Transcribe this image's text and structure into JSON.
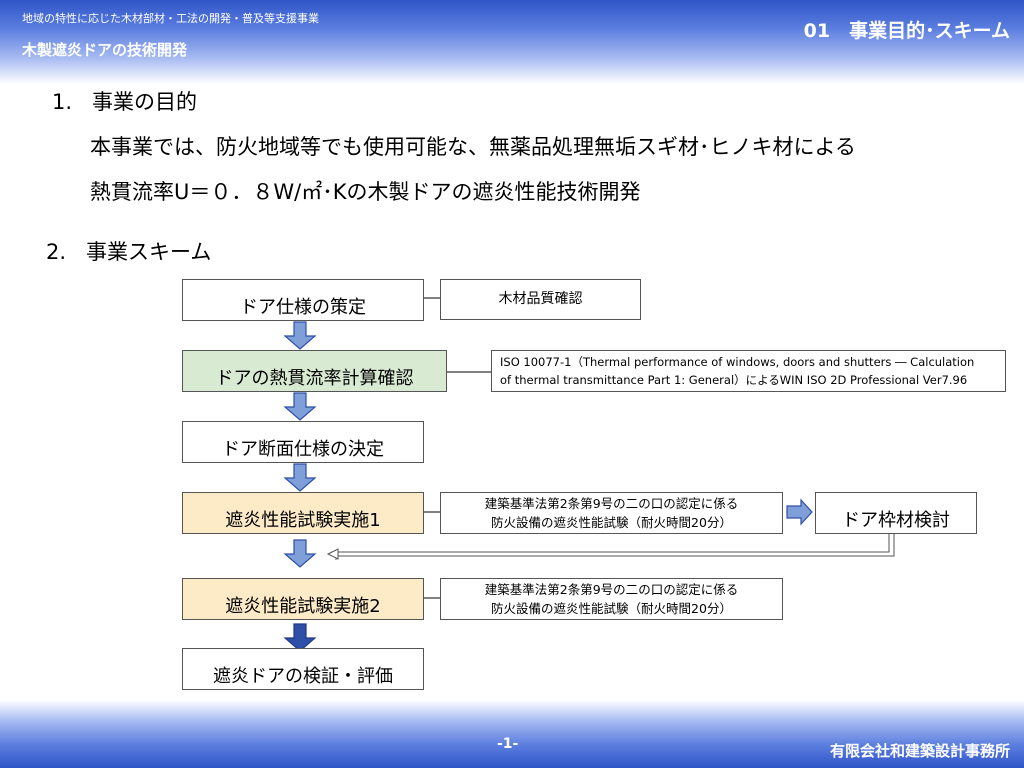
{
  "header": {
    "subtitle": "地域の特性に応じた木材部材・工法の開発・普及等支援事業",
    "title": "木製遮炎ドアの技術開発",
    "section_label": "01　事業目的･スキーム"
  },
  "sections": [
    {
      "number": "1.",
      "heading": "事業の目的"
    },
    {
      "number": "2.",
      "heading": "事業スキーム"
    }
  ],
  "purpose_lines": [
    "本事業では、防火地域等でも使用可能な、無薬品処理無垢スギ材･ヒノキ材による",
    "熱貫流率U＝０．８W/㎡･Kの木製ドアの遮炎性能技術開発"
  ],
  "flow_steps": [
    "ドア仕様の策定",
    "ドアの熱貫流率計算確認",
    "ドア断面仕様の決定",
    "遮炎性能試験実施1",
    "遮炎性能試験実施2",
    "遮炎ドアの検証・評価"
  ],
  "side_notes": {
    "wood_quality": "木材品質確認",
    "iso_line1": "ISO 10077-1（Thermal performance of windows, doors and shutters ― Calculation",
    "iso_line2": "of thermal transmittance  Part 1: General）によるWIN ISO 2D Professional Ver7.96",
    "test1_line1": "建築基準法第2条第9号の二の口の認定に係る",
    "test1_line2": "防火設備の遮炎性能試験（耐火時間20分）",
    "frame_study": "ドア枠材検討",
    "test2_line1": "建築基準法第2条第9号の二の口の認定に係る",
    "test2_line2": "防火設備の遮炎性能試験（耐火時間20分）"
  },
  "footer": {
    "page_number": "-1-",
    "company": "有限会社和建築設計事務所"
  },
  "colors": {
    "header_blue": "#2f55c8",
    "step_green": "#d9ead3",
    "step_yellow": "#fdebc8",
    "arrow_blue": "#7f9fd8",
    "arrow_dark_blue": "#2e4fa8"
  }
}
